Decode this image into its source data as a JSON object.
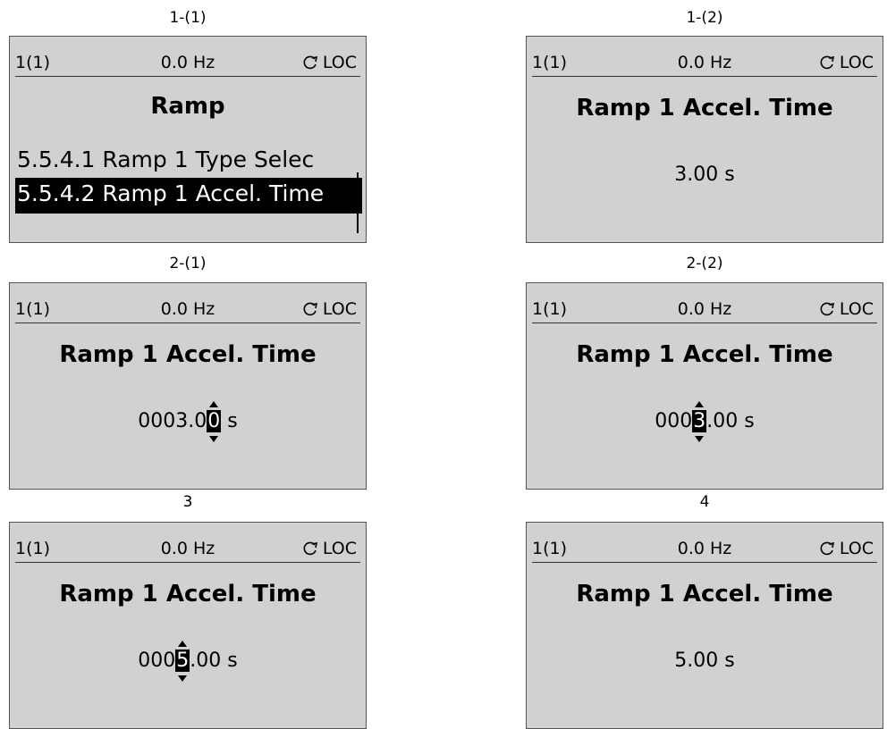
{
  "captions": {
    "p1": "1-(1)",
    "p2": "1-(2)",
    "p3": "2-(1)",
    "p4": "2-(2)",
    "p5": "3",
    "p6": "4"
  },
  "status": {
    "left": "1(1)",
    "center": "0.0 Hz",
    "right": "LOC"
  },
  "menu": {
    "title": "Ramp",
    "items": [
      "5.5.4.1 Ramp 1 Type Selec",
      "5.5.4.2 Ramp 1 Accel. Time"
    ],
    "selected_index": 1
  },
  "param_title": "Ramp 1 Accel. Time",
  "values": {
    "p2": "3.00 s",
    "p3_pre": "0003.0",
    "p3_cursor": "0",
    "p3_post": " s",
    "p4_pre": "000",
    "p4_cursor": "3",
    "p4_post": ".00 s",
    "p5_pre": "000",
    "p5_cursor": "5",
    "p5_post": ".00 s",
    "p6": "5.00 s"
  },
  "icons": {
    "status_right": "rotate-icon"
  }
}
